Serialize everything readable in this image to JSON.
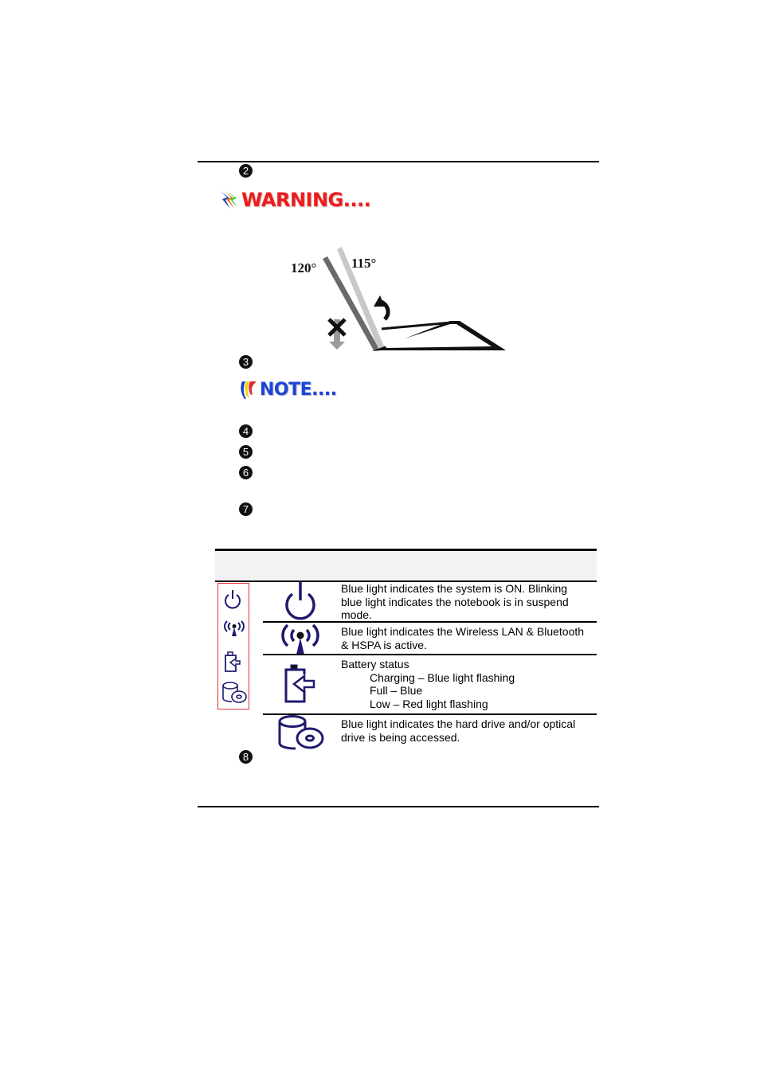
{
  "page": {
    "steps": [
      "2",
      "3",
      "4",
      "5",
      "6",
      "7",
      "8"
    ]
  },
  "warning": {
    "label": "WARNING....",
    "color": "#ee1c1c"
  },
  "note": {
    "label": "NOTE....",
    "color": "#1b45d6"
  },
  "figure": {
    "angle_max_label": "120°",
    "angle_ok_label": "115°"
  },
  "indicator_table": {
    "icon_color": "#1f1a6e",
    "legend_border_color": "#e0353a",
    "header_bg": "#f2f2f2",
    "rows": [
      {
        "icon": "power-icon",
        "lines": [
          "Blue light indicates the system is ON. Blinking",
          "blue  light indicates the notebook is in suspend",
          "mode."
        ]
      },
      {
        "icon": "wireless-icon",
        "lines": [
          "Blue light indicates the Wireless LAN & Bluetooth",
          "& HSPA is active."
        ]
      },
      {
        "icon": "battery-icon",
        "title": "Battery status",
        "states": [
          "Charging – Blue light flashing",
          "Full – Blue",
          "Low – Red light flashing"
        ]
      },
      {
        "icon": "drive-icon",
        "lines": [
          "Blue light indicates the hard drive and/or optical",
          "drive is being accessed."
        ]
      }
    ]
  }
}
